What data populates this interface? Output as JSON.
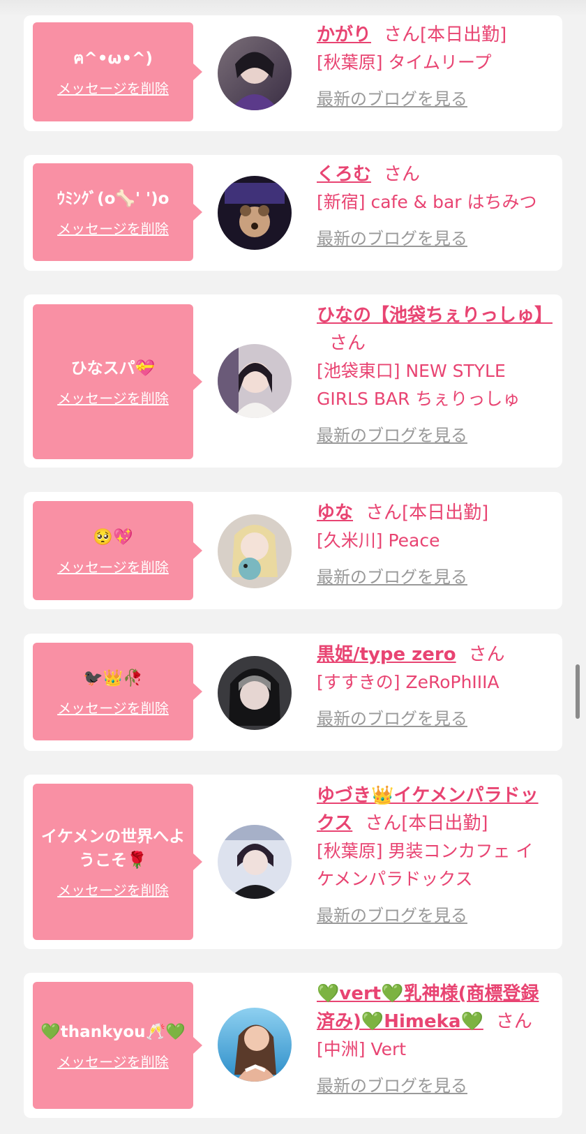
{
  "delete_label": "メッセージを削除",
  "blog_label": "最新のブログを見る",
  "san_label": "さん",
  "colors": {
    "bubble": "#f990a4",
    "name": "#e84472",
    "link_gray": "#999999",
    "card": "#ffffff",
    "page": "#f2f2f2"
  },
  "items": [
    {
      "message": "ฅ^•ω•^)",
      "name": "かがり",
      "status": "[本日出勤]",
      "shop": "[秋葉原] タイムリープ",
      "avatar": "avatar-photo"
    },
    {
      "message": "ｳﾐﾝｸﾞ(o🦴' ')o",
      "name": "くろむ",
      "status": "",
      "shop": "[新宿] cafe & bar はちみつ",
      "avatar": "avatar-photo"
    },
    {
      "message": "ひなスパ💝",
      "name": "ひなの【池袋ちぇりっしゅ】",
      "status": "",
      "shop": "[池袋東口] NEW STYLE GIRLS BAR ちぇりっしゅ",
      "avatar": "avatar-photo"
    },
    {
      "message": "🥺💖",
      "name": "ゆな",
      "status": "[本日出勤]",
      "shop": "[久米川] Peace",
      "avatar": "avatar-photo"
    },
    {
      "message": "🐦‍⬛👑🥀",
      "name": "黒姫/type zero",
      "status": "",
      "shop": "[すすきの] ZeRoPhIIIA",
      "avatar": "avatar-photo"
    },
    {
      "message": "イケメンの世界へようこそ🌹",
      "name": "ゆづき👑イケメンパラドックス",
      "status": "[本日出勤]",
      "shop": "[秋葉原] 男装コンカフェ イケメンパラドックス",
      "avatar": "avatar-photo"
    },
    {
      "message": "💚thankyou🥂💚",
      "name": "💚vert💚乳神様(商標登録済み)💚Himeka💚",
      "status": "",
      "shop": "[中洲] Vert",
      "avatar": "avatar-photo"
    }
  ]
}
